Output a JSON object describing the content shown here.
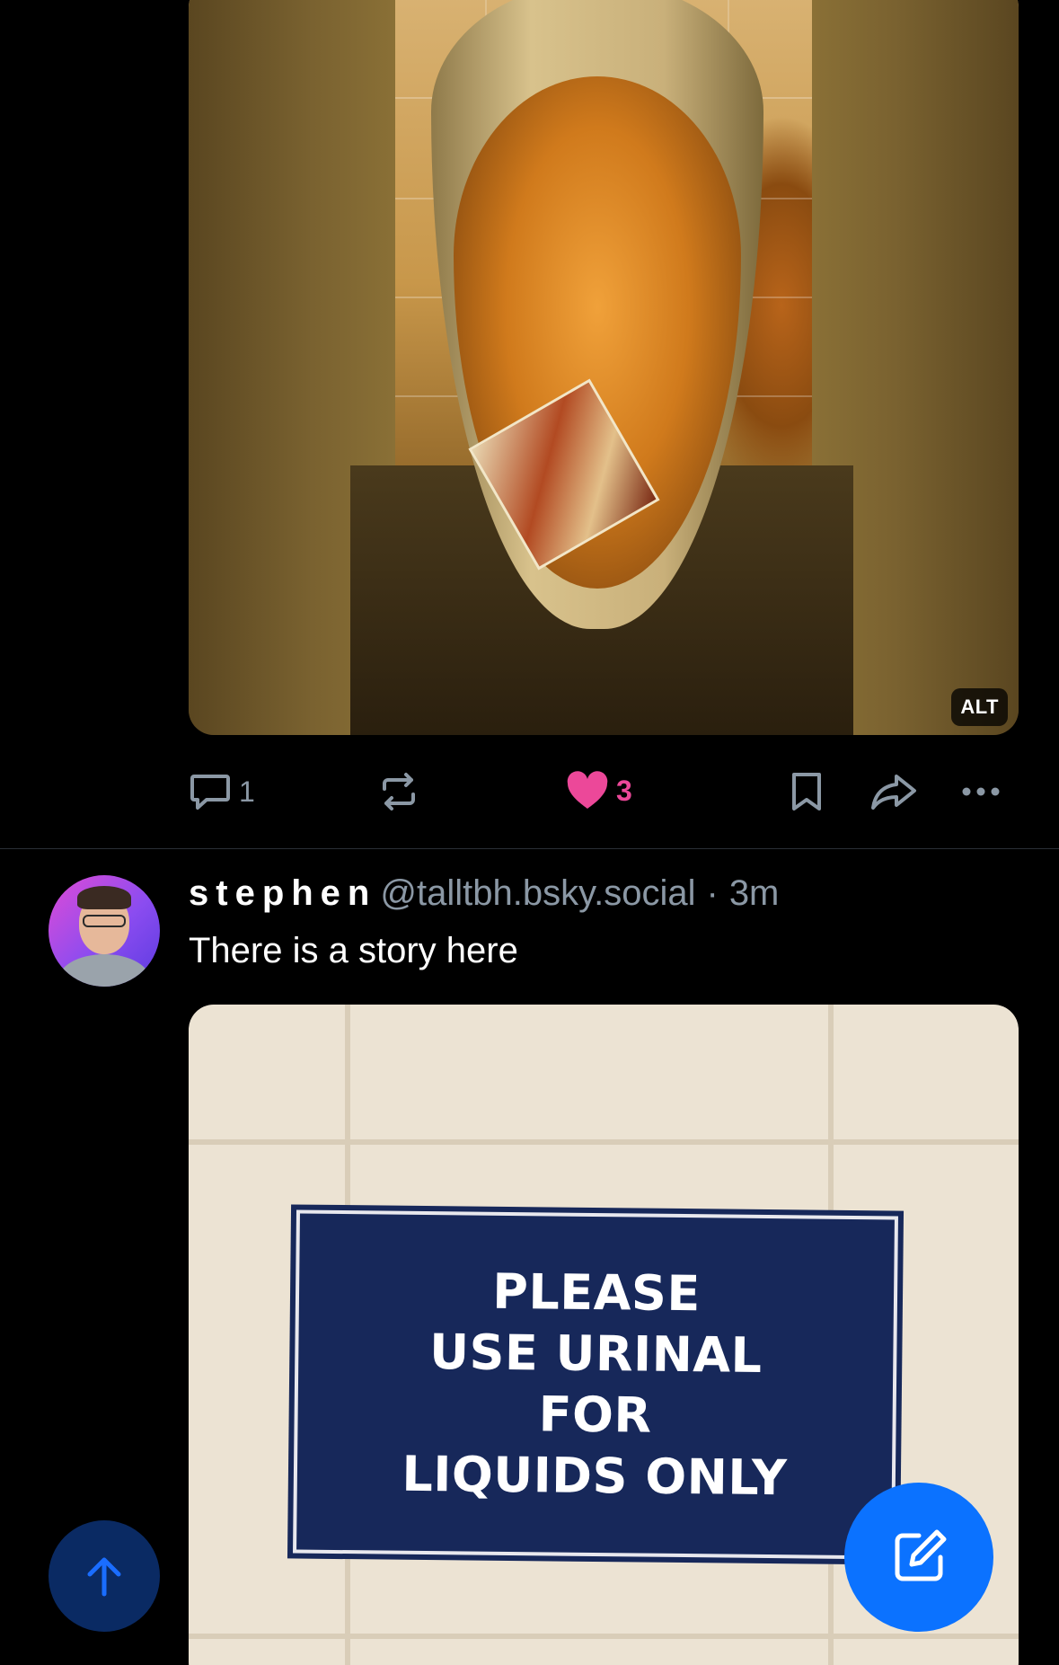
{
  "post1": {
    "image": {
      "alt_badge": "ALT",
      "description_icon": "golden-urinal-photo"
    },
    "actions": {
      "reply_count": "1",
      "repost_count": "",
      "like_count": "3",
      "liked": true
    }
  },
  "post2": {
    "author": {
      "display_name": "stephen",
      "handle": "@talltbh.bsky.social",
      "separator": "·",
      "time": "3m"
    },
    "text": "There is a story here",
    "image": {
      "sign_lines": [
        "PLEASE",
        "USE URINAL",
        "FOR",
        "LIQUIDS ONLY"
      ]
    }
  },
  "colors": {
    "background": "#000000",
    "like_pink": "#ec4899",
    "muted": "#8b98a5",
    "compose_blue": "#0b72ff",
    "scroll_top_blue": "#0a2a63"
  },
  "icons": {
    "reply": "speech-bubble-icon",
    "repost": "repost-arrows-icon",
    "like": "heart-icon",
    "bookmark": "bookmark-icon",
    "share": "share-arrow-icon",
    "more": "ellipsis-icon",
    "scroll_top": "arrow-up-icon",
    "compose": "compose-pencil-icon"
  }
}
